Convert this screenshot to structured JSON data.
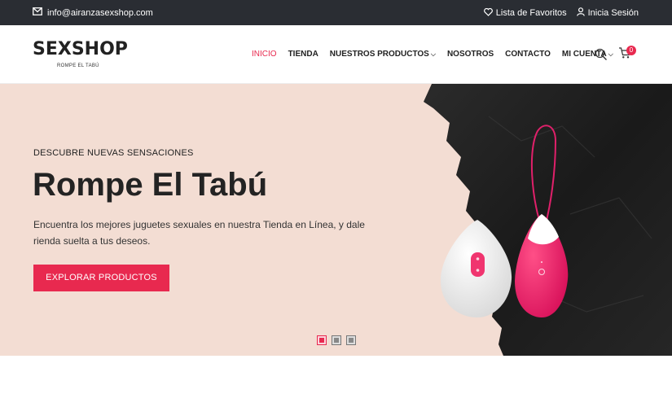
{
  "topbar": {
    "email": "info@airanzasexshop.com",
    "wishlist": "Lista de Favoritos",
    "login": "Inicia Sesión"
  },
  "header": {
    "logo_text": "SEXSHOP",
    "logo_tagline": "ROMPE EL TABÚ",
    "nav": [
      {
        "label": "INICIO",
        "active": true
      },
      {
        "label": "TIENDA"
      },
      {
        "label": "NUESTROS PRODUCTOS",
        "dropdown": true
      },
      {
        "label": "NOSOTROS"
      },
      {
        "label": "CONTACTO"
      },
      {
        "label": "MI CUENTA",
        "dropdown": true
      }
    ],
    "cart_count": "0"
  },
  "hero": {
    "eyebrow": "DESCUBRE NUEVAS SENSACIONES",
    "title": "Rompe El Tabú",
    "text": "Encuentra los mejores juguetes sexuales en nuestra Tienda en Línea, y dale rienda suelta a tus deseos.",
    "cta": "EXPLORAR PRODUCTOS",
    "slides": 3,
    "active_slide": 1
  },
  "colors": {
    "accent": "#e8294f",
    "topbar": "#2a2d33",
    "hero_bg": "#f3ddd3"
  }
}
